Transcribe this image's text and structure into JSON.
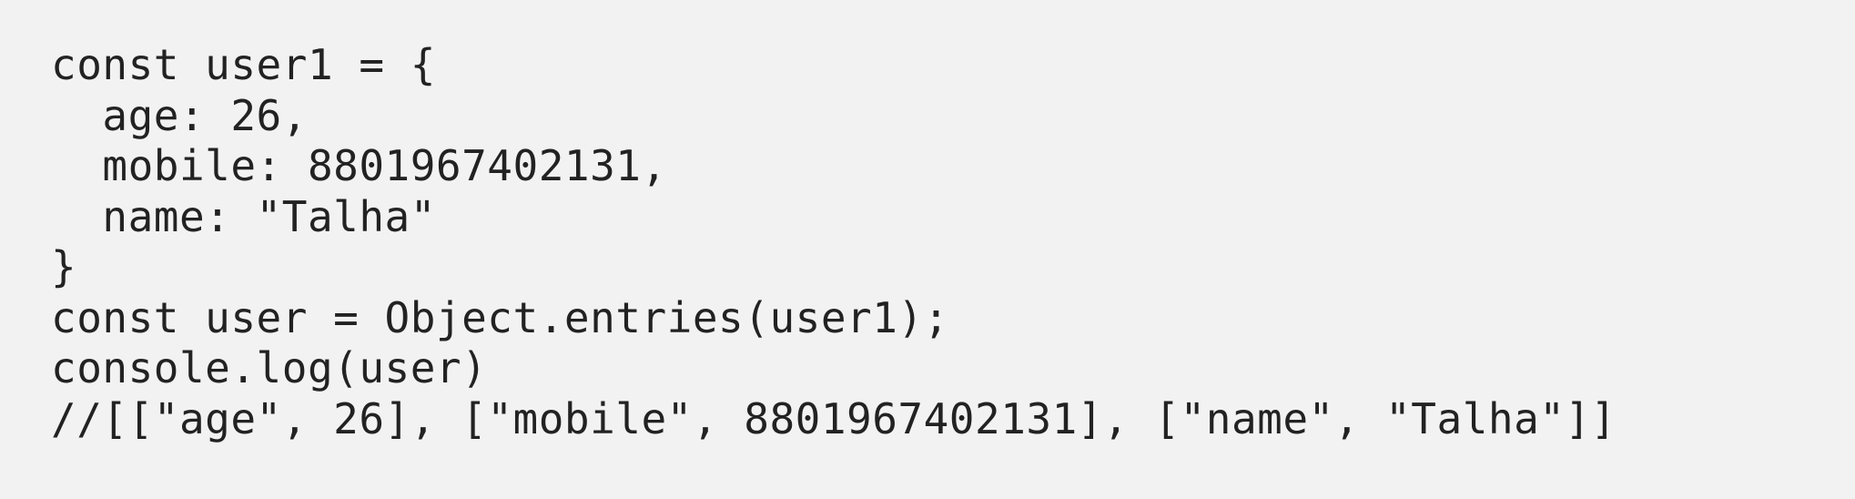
{
  "code": {
    "lines": [
      "const user1 = {",
      "  age: 26,",
      "  mobile: 8801967402131,",
      "  name: \"Talha\"",
      "}",
      "const user = Object.entries(user1);",
      "console.log(user)",
      "//[[\"age\", 26], [\"mobile\", 8801967402131], [\"name\", \"Talha\"]]"
    ]
  }
}
